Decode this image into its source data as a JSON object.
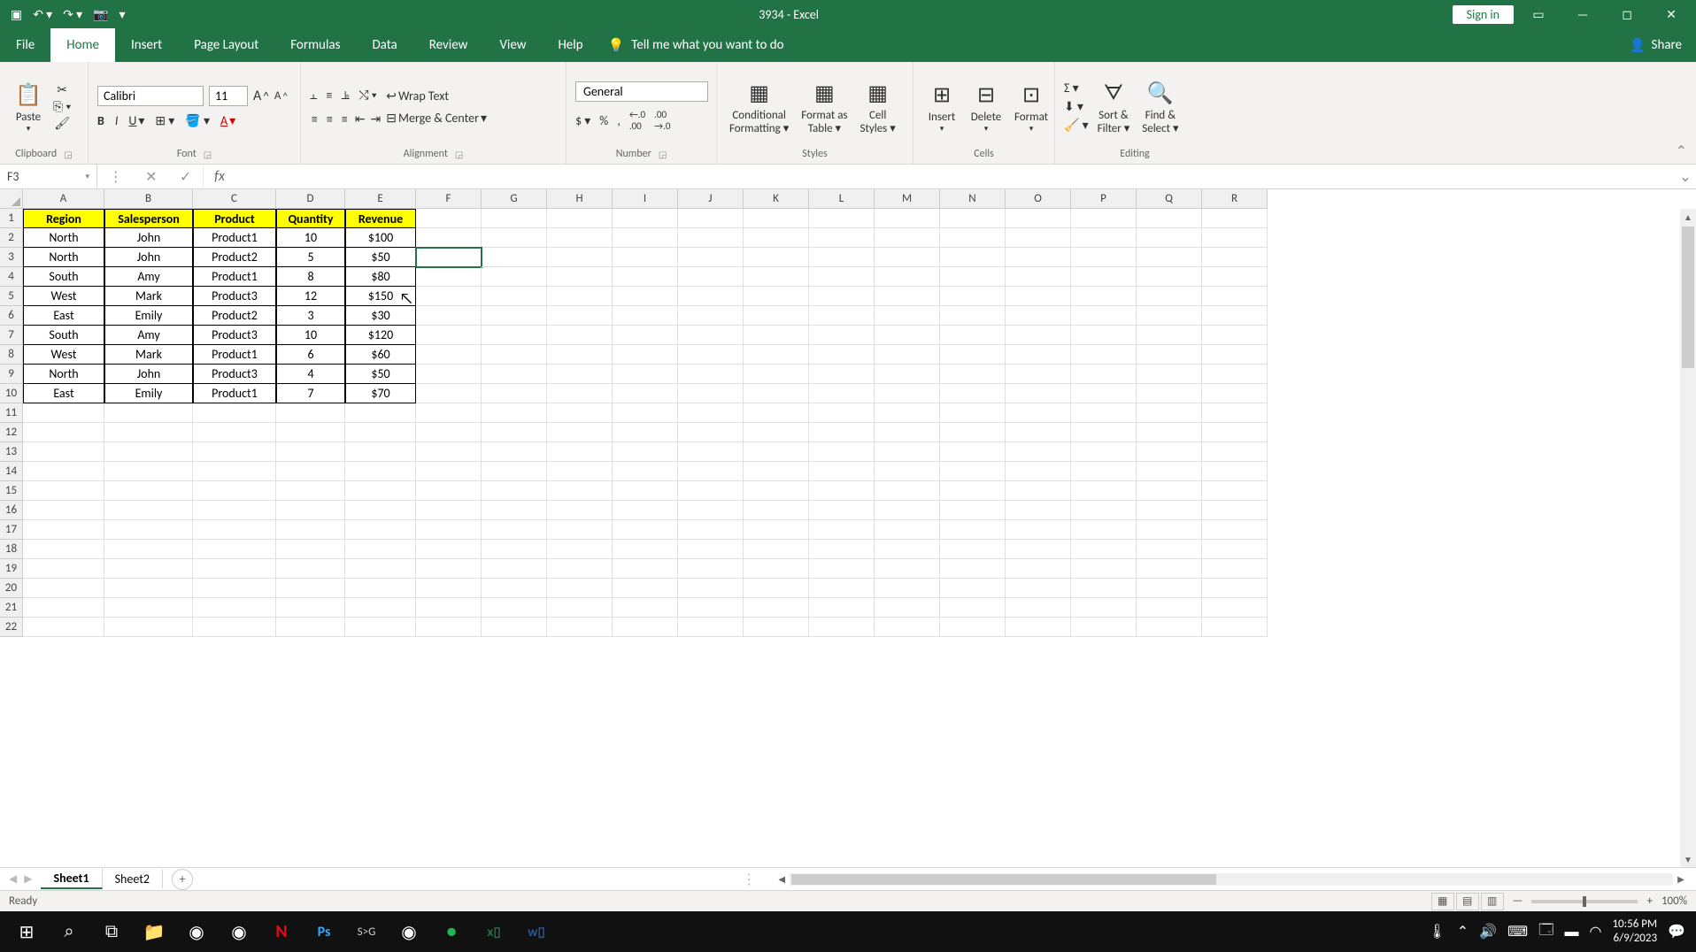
{
  "titlebar": {
    "title": "3934  -  Excel",
    "signin": "Sign in"
  },
  "tabs": {
    "file": "File",
    "home": "Home",
    "insert": "Insert",
    "pagelayout": "Page Layout",
    "formulas": "Formulas",
    "data": "Data",
    "review": "Review",
    "view": "View",
    "help": "Help",
    "tellme": "Tell me what you want to do",
    "share": "Share"
  },
  "ribbon": {
    "clipboard": {
      "paste": "Paste",
      "label": "Clipboard"
    },
    "font": {
      "name": "Calibri",
      "size": "11",
      "bold": "B",
      "italic": "I",
      "underline": "U",
      "label": "Font"
    },
    "alignment": {
      "wrap": "Wrap Text",
      "merge": "Merge & Center",
      "label": "Alignment"
    },
    "number": {
      "format": "General",
      "label": "Number"
    },
    "styles": {
      "cond": "Conditional",
      "cond2": "Formatting",
      "fmtas": "Format as",
      "fmtas2": "Table",
      "cellstyles": "Cell",
      "cellstyles2": "Styles",
      "label": "Styles"
    },
    "cells": {
      "insert": "Insert",
      "delete": "Delete",
      "format": "Format",
      "label": "Cells"
    },
    "editing": {
      "sortfilter": "Sort &",
      "sortfilter2": "Filter",
      "findselect": "Find &",
      "findselect2": "Select",
      "label": "Editing"
    }
  },
  "formula_bar": {
    "cell_ref": "F3",
    "fx": "fx",
    "formula": ""
  },
  "columns": [
    "A",
    "B",
    "C",
    "D",
    "E",
    "F",
    "G",
    "H",
    "I",
    "J",
    "K",
    "L",
    "M",
    "N",
    "O",
    "P",
    "Q",
    "R"
  ],
  "col_widths": {
    "A": "cw-A",
    "B": "cw-B",
    "C": "cw-C",
    "D": "cw-D",
    "E": "cw-E"
  },
  "headers": [
    "Region",
    "Salesperson",
    "Product",
    "Quantity",
    "Revenue"
  ],
  "data_rows": [
    [
      "North",
      "John",
      "Product1",
      "10",
      "$100"
    ],
    [
      "North",
      "John",
      "Product2",
      "5",
      "$50"
    ],
    [
      "South",
      "Amy",
      "Product1",
      "8",
      "$80"
    ],
    [
      "West",
      "Mark",
      "Product3",
      "12",
      "$150"
    ],
    [
      "East",
      "Emily",
      "Product2",
      "3",
      "$30"
    ],
    [
      "South",
      "Amy",
      "Product3",
      "10",
      "$120"
    ],
    [
      "West",
      "Mark",
      "Product1",
      "6",
      "$60"
    ],
    [
      "North",
      "John",
      "Product3",
      "4",
      "$50"
    ],
    [
      "East",
      "Emily",
      "Product1",
      "7",
      "$70"
    ]
  ],
  "visible_rows": 22,
  "active_cell": {
    "row": 3,
    "col": "F"
  },
  "cursor_overlay_cell": {
    "row": 5,
    "col": "E"
  },
  "sheets": {
    "active": "Sheet1",
    "other": "Sheet2"
  },
  "status": {
    "ready": "Ready",
    "zoom": "100%"
  },
  "taskbar": {
    "time": "10:56 PM",
    "date": "6/9/2023"
  }
}
